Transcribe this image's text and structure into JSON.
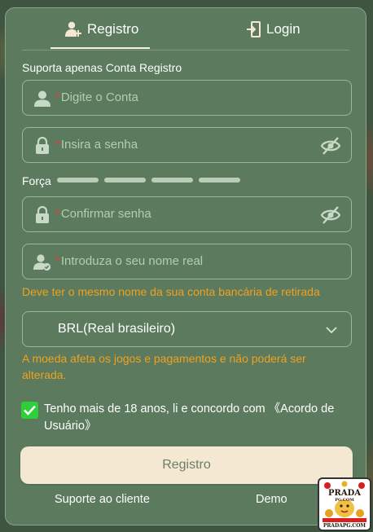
{
  "tabs": {
    "register": "Registro",
    "login": "Login"
  },
  "form": {
    "note": "Suporta apenas Conta Registro",
    "account_placeholder": "Digite o Conta",
    "password_placeholder": "Insira a senha",
    "strength_label": "Força",
    "confirm_placeholder": "Confirmar senha",
    "realname_placeholder": "Introduza o seu nome real",
    "realname_warning": "Deve ter o mesmo nome da sua conta bancária de retirada",
    "currency_value": "BRL(Real brasileiro)",
    "currency_warning": "A moeda afeta os jogos e pagamentos e não poderá ser alterada.",
    "agree_checked": true,
    "agree_text": "Tenho mais de 18 anos, li e concordo com 《Acordo de Usuário》",
    "required_mark": "*",
    "submit_label": "Registro"
  },
  "footer": {
    "support": "Suporte ao cliente",
    "demo": "Demo"
  },
  "badge": {
    "brand": "PRADA",
    "brand_sub": "PG.COM",
    "url": "PRADAPG.COM"
  },
  "colors": {
    "panel": "#5c7b5e",
    "accent_check": "#2ecf3a",
    "warning": "#f0a020",
    "button_bg": "#f5e8d3"
  }
}
